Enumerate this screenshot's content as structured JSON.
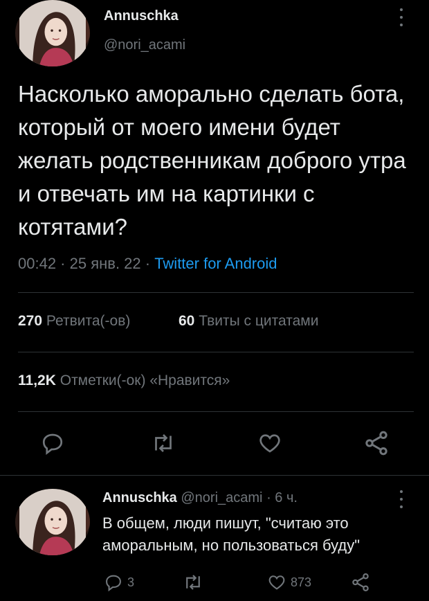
{
  "tweet": {
    "author_name": "Annuschka",
    "author_handle": "@nori_acami",
    "text": "Насколько аморально сделать бота, который от моего имени будет желать родственникам доброго утра и отвечать им на картинки с котятами?",
    "time": "00:42 · 25 янв. 22 · ",
    "source": "Twitter for Android",
    "retweets_count": "270",
    "retweets_label": "Ретвита(-ов)",
    "quotes_count": "60",
    "quotes_label": "Твиты с цитатами",
    "likes_count": "11,2K",
    "likes_label": "Отметки(-ок) «Нравится»"
  },
  "reply": {
    "author_name": "Annuschka",
    "author_handle": "@nori_acami",
    "age": "· 6 ч.",
    "text": "В общем, люди пишут, \"считаю это аморальным, но пользоваться буду\"",
    "reply_count": "3",
    "like_count": "873"
  },
  "colors": {
    "background": "#000000",
    "text": "#e7e9ea",
    "muted": "#71767b",
    "link": "#1d9bf0",
    "divider": "#2f3336"
  },
  "icons": [
    "reply-icon",
    "retweet-icon",
    "like-icon",
    "share-icon",
    "more-icon"
  ]
}
